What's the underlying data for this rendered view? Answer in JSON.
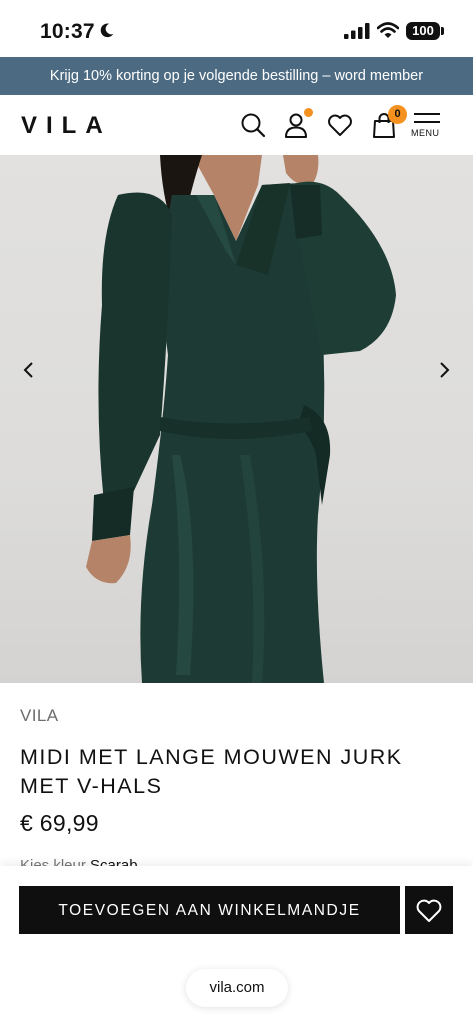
{
  "status_bar": {
    "time": "10:37",
    "battery": "100"
  },
  "promo": {
    "text": "Krijg 10% korting op je volgende bestilling – word member"
  },
  "header": {
    "logo": "VILA",
    "bag_count": "0",
    "menu_label": "MENU"
  },
  "product": {
    "brand": "VILA",
    "title": "MIDI MET LANGE MOUWEN JURK MET V-HALS",
    "price": "€ 69,99",
    "color_label": "Kies kleur",
    "color_value": "Scarab"
  },
  "actions": {
    "add_to_cart": "TOEVOEGEN AAN WINKELMANDJE"
  },
  "browser": {
    "url": "vila.com"
  },
  "colors": {
    "promo_bg": "#4c6b82",
    "badge": "#f5911e",
    "dress": "#1d3b34",
    "button": "#0f0f0f"
  },
  "icons": [
    "moon-icon",
    "signal-icon",
    "wifi-icon",
    "search-icon",
    "account-icon",
    "heart-icon",
    "bag-icon",
    "menu-icon",
    "chevron-left-icon",
    "chevron-right-icon",
    "heart-outline-icon"
  ]
}
